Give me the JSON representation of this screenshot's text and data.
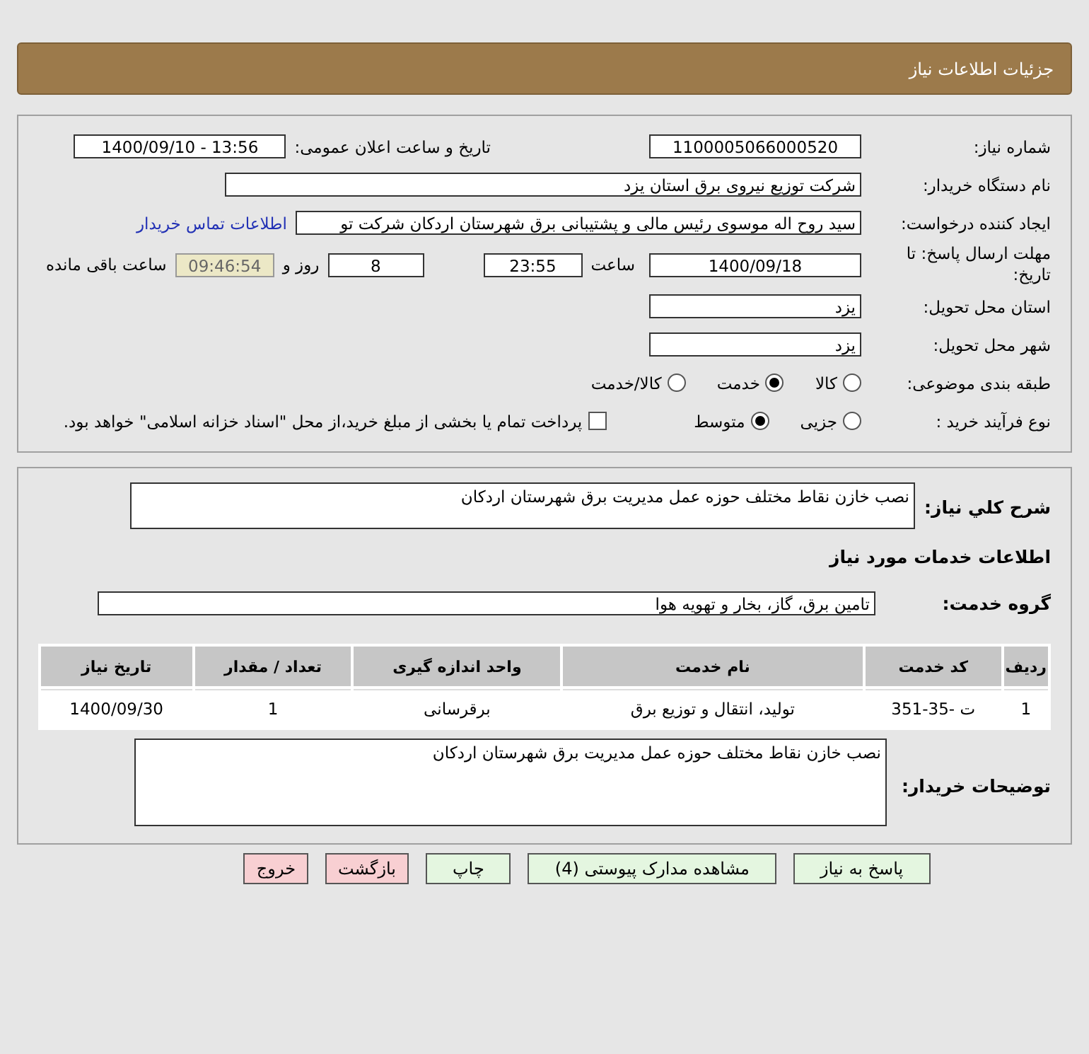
{
  "header": {
    "title": "جزئیات اطلاعات نیاز"
  },
  "details": {
    "need_number": {
      "label": "شماره نیاز:",
      "value": "1100005066000520"
    },
    "announce": {
      "label": "تاریخ و ساعت اعلان عمومی:",
      "value": "1400/09/10 - 13:56"
    },
    "buyer": {
      "label": "نام دستگاه خریدار:",
      "value": "شرکت توزیع نیروی برق استان یزد"
    },
    "requester": {
      "label": "ایجاد کننده درخواست:",
      "value": "سید روح اله  موسوی  رئیس مالی و پشتیبانی برق شهرستان اردکان  شرکت تو",
      "link": "اطلاعات تماس خریدار"
    },
    "deadline": {
      "label": "مهلت ارسال پاسخ: تا تاریخ:",
      "date": "1400/09/18",
      "time_label": "ساعت",
      "time": "23:55",
      "days": "8",
      "days_label": "روز و",
      "remaining": "09:46:54",
      "remaining_label": "ساعت باقی مانده"
    },
    "province": {
      "label": "استان محل تحویل:",
      "value": "یزد"
    },
    "city": {
      "label": "شهر محل تحویل:",
      "value": "یزد"
    },
    "category": {
      "label": "طبقه بندی موضوعی:",
      "options": [
        {
          "label": "کالا",
          "selected": false
        },
        {
          "label": "خدمت",
          "selected": true
        },
        {
          "label": "کالا/خدمت",
          "selected": false
        }
      ]
    },
    "process": {
      "label": "نوع فرآیند خرید :",
      "options": [
        {
          "label": "جزیی",
          "selected": false
        },
        {
          "label": "متوسط",
          "selected": true
        }
      ],
      "payment": {
        "label": "پرداخت تمام یا بخشی از مبلغ خرید،از محل \"اسناد خزانه اسلامی\" خواهد بود.",
        "checked": false
      }
    }
  },
  "summary": {
    "label": "شرح کلي نياز:",
    "value": "نصب خازن نقاط مختلف حوزه عمل مدیریت برق شهرستان اردکان"
  },
  "services_title": "اطلاعات خدمات مورد نیاز",
  "service_group": {
    "label": "گروه خدمت:",
    "value": "تامین برق، گاز، بخار و تهویه هوا"
  },
  "table": {
    "columns": [
      "ردیف",
      "کد خدمت",
      "نام خدمت",
      "واحد اندازه گیری",
      "تعداد / مقدار",
      "تاریخ نیاز"
    ],
    "rows": [
      [
        "1",
        "ت -35-351",
        "تولید، انتقال و توزیع برق",
        "برقرسانی",
        "1",
        "1400/09/30"
      ]
    ]
  },
  "buyer_notes": {
    "label": "توضیحات خریدار:",
    "value": "نصب خازن نقاط مختلف حوزه عمل مدیریت برق شهرستان اردکان"
  },
  "buttons": [
    {
      "label": "پاسخ به نیاز",
      "kind": "normal"
    },
    {
      "label": "مشاهده مدارک پیوستی (4)",
      "kind": "normal"
    },
    {
      "label": "چاپ",
      "kind": "normal"
    },
    {
      "label": "بازگشت",
      "kind": "danger"
    },
    {
      "label": "خروج",
      "kind": "danger"
    }
  ]
}
